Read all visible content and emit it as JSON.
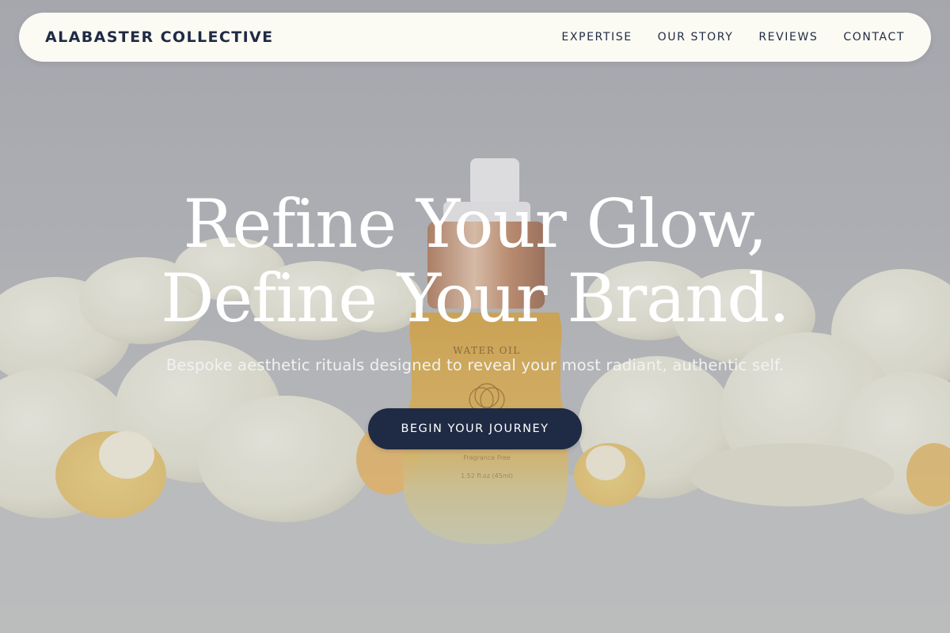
{
  "header": {
    "brand": "ALABASTER COLLECTIVE",
    "nav": [
      {
        "label": "EXPERTISE"
      },
      {
        "label": "OUR STORY"
      },
      {
        "label": "REVIEWS"
      },
      {
        "label": "CONTACT"
      }
    ]
  },
  "hero": {
    "headline_line1": "Refine Your Glow,",
    "headline_line2": "Define Your Brand.",
    "subheadline": "Bespoke aesthetic rituals designed to reveal your most radiant, authentic self.",
    "cta_label": "BEGIN YOUR JOURNEY",
    "bottle_label": "WATER OIL",
    "bottle_note": "Fragrance Free",
    "bottle_volume": "1.52 fl.oz (45ml)"
  },
  "colors": {
    "accent": "#1f2a44",
    "nav_background": "#fbfaf3",
    "headline": "#ffffff"
  }
}
